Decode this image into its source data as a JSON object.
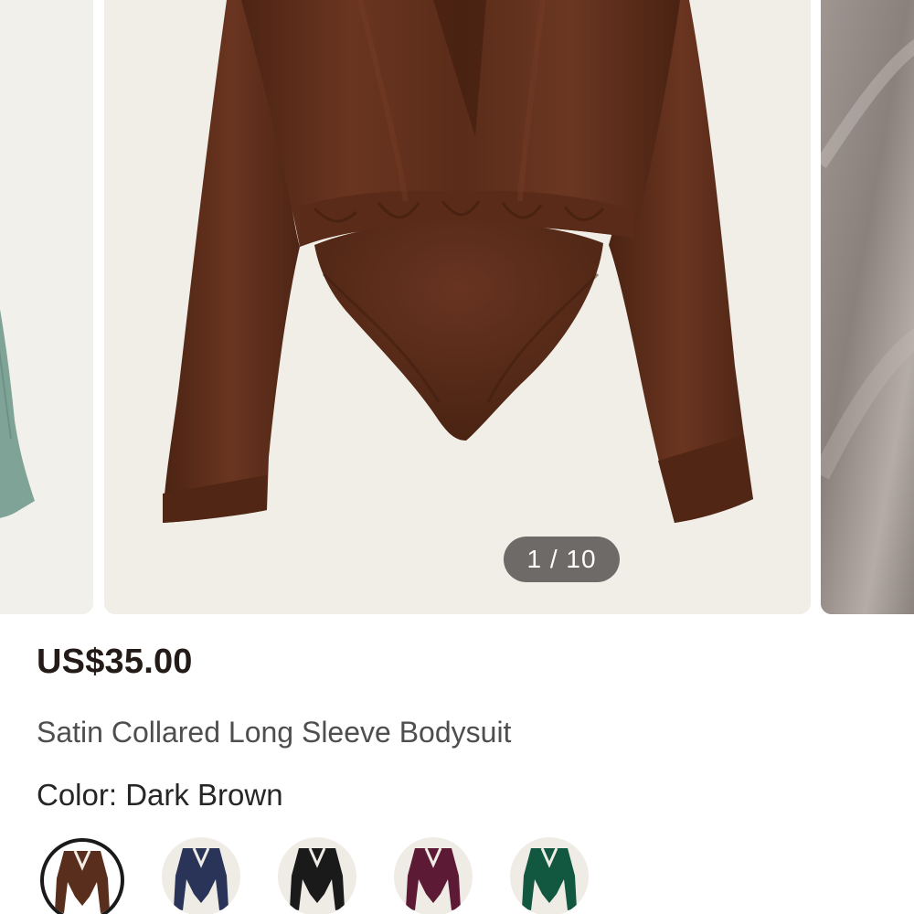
{
  "gallery": {
    "counter": "1 / 10",
    "images": [
      {
        "name": "Satin Collared Long Sleeve Bodysuit - Sage Green"
      },
      {
        "name": "Satin Collared Long Sleeve Bodysuit - Dark Brown"
      },
      {
        "name": "Satin fabric detail"
      }
    ]
  },
  "product": {
    "price": "US$35.00",
    "title": "Satin Collared Long Sleeve Bodysuit",
    "color_label": "Color:",
    "color_value": "Dark Brown"
  },
  "swatches": [
    {
      "color": "#5a2e1d",
      "selected": true
    },
    {
      "color": "#2a3358",
      "selected": false
    },
    {
      "color": "#1b1a1a",
      "selected": false
    },
    {
      "color": "#5c1a34",
      "selected": false
    },
    {
      "color": "#12573f",
      "selected": false
    }
  ],
  "colors": {
    "brown_main": "#5f2f1c",
    "sage": "#7fa497",
    "fabric": "#8e8581"
  }
}
